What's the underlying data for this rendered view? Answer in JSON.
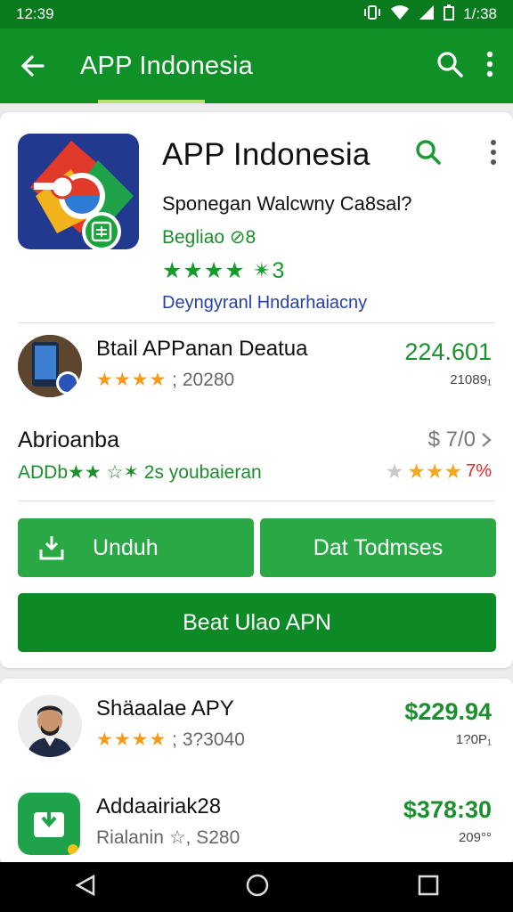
{
  "status_bar": {
    "time_left": "12:39",
    "time_right": "1/:38"
  },
  "app_bar": {
    "title": "APP Indonesia"
  },
  "hero": {
    "title": "APP Indonesia",
    "subtitle": "Sponegan Walcwny Ca8sal?",
    "tag": "Begliao ⊘8",
    "rating_stars": "★★★★ ✴3",
    "developer": "Deyngyranl Hndarhaiacny"
  },
  "items": [
    {
      "name": "Btail APPanan Deatua",
      "stars": "★★★★",
      "rating": "; 20280",
      "price": "224.601",
      "small": "21089₁"
    },
    {
      "name": "Abrioanba",
      "meta_left": "ADDb★★ ☆✶ 2s youbaieran",
      "price": "$ 7/0",
      "meta_right_pct": "7%"
    }
  ],
  "buttons": {
    "download": "Unduh",
    "details": "Dat Todmses",
    "primary": "Beat Ulao APN"
  },
  "list2": [
    {
      "name": "Shäaalae APY",
      "stars": "★★★★",
      "rating": "; 3?3040",
      "price": "$229.94",
      "small": "1?0P₁"
    },
    {
      "name": "Addaairiak28",
      "meta": "Rialanin ☆, S280",
      "price": "$378:30",
      "small": "209°°"
    }
  ],
  "colors": {
    "status": "#0a7a1f",
    "appbar": "#109128",
    "accent": "#2aa845",
    "primary": "#0d8a26"
  }
}
